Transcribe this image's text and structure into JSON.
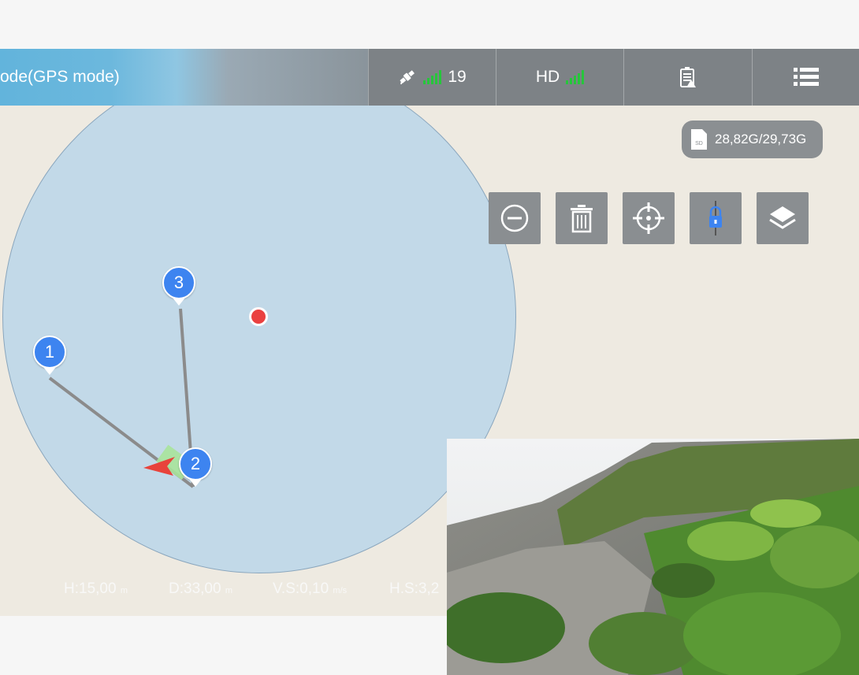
{
  "topbar": {
    "mode_label": "ode(GPS mode)",
    "satellite_count": "19",
    "hd_label": "HD",
    "satellite_icon": "satellite-icon",
    "signal_icon": "signal-bars-icon",
    "battery_icon": "battery-warning-icon",
    "menu_icon": "list-menu-icon"
  },
  "storage": {
    "text": "28,82G/29,73G",
    "icon": "sd-card-icon"
  },
  "tools": [
    {
      "name": "zoom-out-button",
      "icon": "minus-circle-icon"
    },
    {
      "name": "delete-button",
      "icon": "trash-icon"
    },
    {
      "name": "locate-button",
      "icon": "crosshair-icon"
    },
    {
      "name": "lock-button",
      "icon": "lock-icon"
    },
    {
      "name": "layers-button",
      "icon": "layers-icon"
    }
  ],
  "waypoints": [
    {
      "label": "1"
    },
    {
      "label": "2"
    },
    {
      "label": "3"
    }
  ],
  "telemetry": {
    "h": "H:15,00",
    "h_unit": "m",
    "d": "D:33,00",
    "d_unit": "m",
    "vs": "V.S:0,10",
    "vs_unit": "m/s",
    "hs": "H.S:3,2"
  },
  "colors": {
    "signal": "#26c63b",
    "waypoint": "#3d84f0",
    "home_point": "#ea4140",
    "aircraft": "#e8433b",
    "lock_icon": "#3d84f0"
  }
}
